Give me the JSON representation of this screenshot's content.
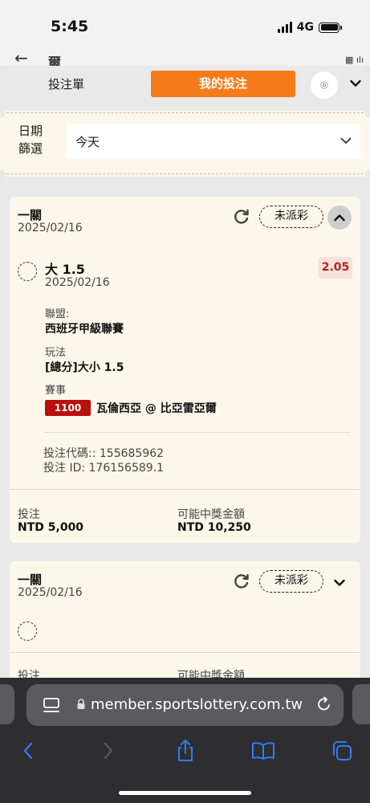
{
  "status_bar": {
    "time": "5:45",
    "network": "4G"
  },
  "peek_header": {
    "back_icon": "arrow-left-icon",
    "title": "爾"
  },
  "tabs": {
    "bet_slip": "投注單",
    "my_bets": "我的投注",
    "accent": "#f67c1b"
  },
  "filter": {
    "label": "日期篩選",
    "value": "今天"
  },
  "bets": [
    {
      "type": "一關",
      "date": "2025/02/16",
      "status": "未派彩",
      "selection": "大 1.5",
      "selection_date": "2025/02/16",
      "odds": "2.05",
      "league_label": "聯盟:",
      "league": "西班牙甲級聯賽",
      "market_label": "玩法",
      "market": "[總分]大小 1.5",
      "event_label": "賽事",
      "event_code": "1100",
      "event_name": "瓦倫西亞 @ 比亞雷亞爾",
      "bet_code": "投注代碼:: 155685962",
      "bet_id": "投注 ID: 176156589.1",
      "stake_label": "投注",
      "stake": "NTD 5,000",
      "payout_label": "可能中獎金額",
      "payout": "NTD 10,250"
    },
    {
      "type": "一關",
      "date": "2025/02/16",
      "status": "未派彩",
      "stake_label": "投注",
      "payout_label": "可能中獎金額"
    }
  ],
  "browser": {
    "url": "member.sportslottery.com.tw"
  },
  "colors": {
    "odds_text": "#b4231c",
    "event_badge": "#b80f0f",
    "card_bg": "#fbf7ea"
  }
}
